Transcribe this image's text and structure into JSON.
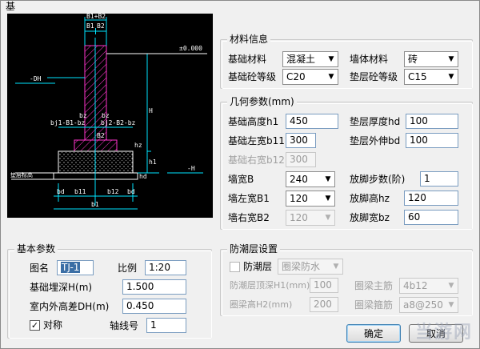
{
  "window": {
    "title_fragment": "基"
  },
  "drawing": {
    "dim_top": "B1+B2",
    "dim_b1": "B1",
    "dim_b2": "B2",
    "elev_label": "±0.000",
    "dh_label": "-DH",
    "h_label": "H",
    "neg_h_label": "-H",
    "bj1_label": "bj1-B1-bz",
    "bj2_label": "bj2-B2-bz",
    "bz_left": "bz",
    "bz_right": "bz",
    "layer_label": "垫层标高",
    "bd_left": "bd",
    "b11_label": "b11",
    "b12_label": "b12",
    "bd_right": "bd",
    "b1_label": "b1",
    "h1_label": "h1",
    "hz_label": "hz",
    "hd_label": "hd",
    "dim_b2_small": "B2"
  },
  "material": {
    "title": "材料信息",
    "foundation_material_label": "基础材料",
    "foundation_material_value": "混凝土",
    "wall_material_label": "墙体材料",
    "wall_material_value": "砖",
    "foundation_grade_label": "基础砼等级",
    "foundation_grade_value": "C20",
    "cushion_grade_label": "垫层砼等级",
    "cushion_grade_value": "C15"
  },
  "geometry": {
    "title": "几何参数(mm)",
    "height_h1_label": "基础高度h1",
    "height_h1_value": "450",
    "cushion_thickness_label": "垫层厚度hd",
    "cushion_thickness_value": "100",
    "left_width_label": "基础左宽b11",
    "left_width_value": "300",
    "cushion_ext_label": "垫层外伸bd",
    "cushion_ext_value": "100",
    "right_width_label": "基础右宽b12",
    "right_width_value": "300",
    "wall_thickness_label": "墙宽B",
    "wall_thickness_value": "240",
    "steps_label": "放脚步数(阶)",
    "steps_value": "1",
    "wall_left_label": "墙左宽B1",
    "wall_left_value": "120",
    "foot_height_label": "放脚高hz",
    "foot_height_value": "120",
    "wall_right_label": "墙右宽B2",
    "wall_right_value": "120",
    "foot_width_label": "放脚宽bz",
    "foot_width_value": "60"
  },
  "basic": {
    "title": "基本参数",
    "name_label": "图名",
    "name_value": "TJ-1",
    "scale_label": "比例",
    "scale_value": "1:20",
    "depth_label": "基础埋深H(m)",
    "depth_value": "1.500",
    "diff_label": "室内外高差DH(m)",
    "diff_value": "0.450",
    "symmetric_label": "对称",
    "symmetric_checked": "✓",
    "axis_label": "轴线号",
    "axis_value": "1"
  },
  "moisture": {
    "title": "防潮层设置",
    "enable_label": "防潮层",
    "type_value": "圈梁防水",
    "top_depth_label": "防潮层顶深H1(mm)",
    "top_depth_value": "100",
    "main_bar_label": "圈梁主筋",
    "main_bar_value": "4b12",
    "beam_height_label": "圈梁高H2(mm)",
    "beam_height_value": "200",
    "stirrup_label": "圈梁箍筋",
    "stirrup_value": "a8@250"
  },
  "buttons": {
    "ok": "确定",
    "cancel": "取消"
  },
  "watermark": "当游网"
}
